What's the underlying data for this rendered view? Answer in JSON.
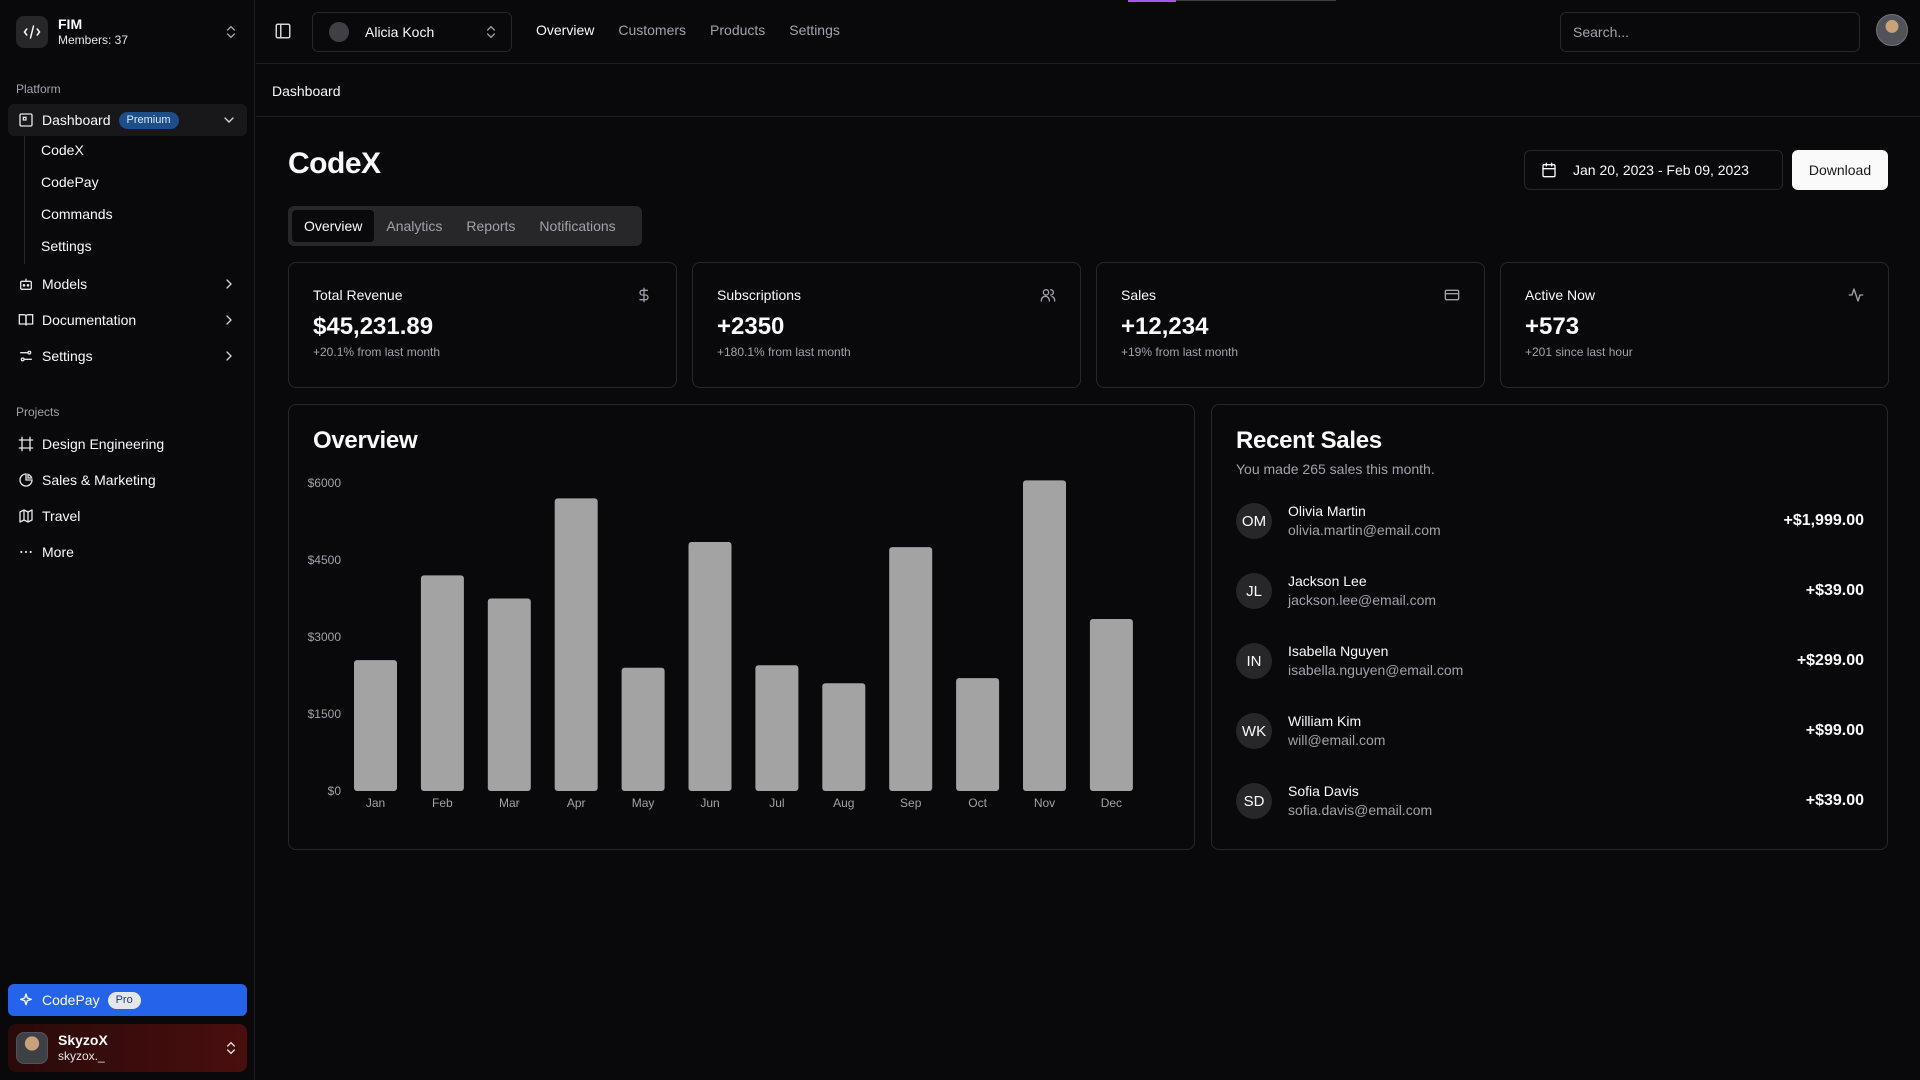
{
  "sidebar": {
    "team": {
      "name": "FIM",
      "members": "Members: 37"
    },
    "platform_label": "Platform",
    "dashboard": {
      "label": "Dashboard",
      "badge": "Premium"
    },
    "dashboard_sub": [
      "CodeX",
      "CodePay",
      "Commands",
      "Settings"
    ],
    "items": [
      {
        "label": "Models"
      },
      {
        "label": "Documentation"
      },
      {
        "label": "Settings"
      }
    ],
    "projects_label": "Projects",
    "projects": [
      {
        "label": "Design Engineering"
      },
      {
        "label": "Sales & Marketing"
      },
      {
        "label": "Travel"
      },
      {
        "label": "More"
      }
    ],
    "promo": {
      "label": "CodePay",
      "badge": "Pro"
    },
    "user": {
      "name": "SkyzoX",
      "handle": "skyzox._"
    }
  },
  "topbar": {
    "account": "Alicia Koch",
    "nav": [
      "Overview",
      "Customers",
      "Products",
      "Settings"
    ],
    "search_placeholder": "Search..."
  },
  "breadcrumb": "Dashboard",
  "main": {
    "title": "CodeX",
    "date_range": "Jan 20, 2023 - Feb 09, 2023",
    "download_label": "Download",
    "tabs": [
      "Overview",
      "Analytics",
      "Reports",
      "Notifications"
    ],
    "stats": [
      {
        "title": "Total Revenue",
        "value": "$45,231.89",
        "note": "+20.1% from last month",
        "icon": "dollar-icon"
      },
      {
        "title": "Subscriptions",
        "value": "+2350",
        "note": "+180.1% from last month",
        "icon": "users-icon"
      },
      {
        "title": "Sales",
        "value": "+12,234",
        "note": "+19% from last month",
        "icon": "credit-card-icon"
      },
      {
        "title": "Active Now",
        "value": "+573",
        "note": "+201 since last hour",
        "icon": "activity-icon"
      }
    ],
    "overview_title": "Overview",
    "recent_sales": {
      "title": "Recent Sales",
      "subtitle": "You made 265 sales this month.",
      "rows": [
        {
          "initials": "OM",
          "name": "Olivia Martin",
          "email": "olivia.martin@email.com",
          "amount": "+$1,999.00"
        },
        {
          "initials": "JL",
          "name": "Jackson Lee",
          "email": "jackson.lee@email.com",
          "amount": "+$39.00"
        },
        {
          "initials": "IN",
          "name": "Isabella Nguyen",
          "email": "isabella.nguyen@email.com",
          "amount": "+$299.00"
        },
        {
          "initials": "WK",
          "name": "William Kim",
          "email": "will@email.com",
          "amount": "+$99.00"
        },
        {
          "initials": "SD",
          "name": "Sofia Davis",
          "email": "sofia.davis@email.com",
          "amount": "+$39.00"
        }
      ]
    }
  },
  "chart_data": {
    "type": "bar",
    "categories": [
      "Jan",
      "Feb",
      "Mar",
      "Apr",
      "May",
      "Jun",
      "Jul",
      "Aug",
      "Sep",
      "Oct",
      "Nov",
      "Dec"
    ],
    "values": [
      2550,
      4200,
      3750,
      5700,
      2400,
      4850,
      2450,
      2100,
      4750,
      2200,
      6050,
      3350
    ],
    "yticks": [
      "$0",
      "$1500",
      "$3000",
      "$4500",
      "$6000"
    ],
    "ylim": [
      0,
      6000
    ],
    "bar_color": "#a3a3a3",
    "grid": false
  },
  "colors": {
    "background": "#09090b",
    "border": "#27272a",
    "accent": "#2563eb",
    "premium_badge": "#1d4e89"
  }
}
